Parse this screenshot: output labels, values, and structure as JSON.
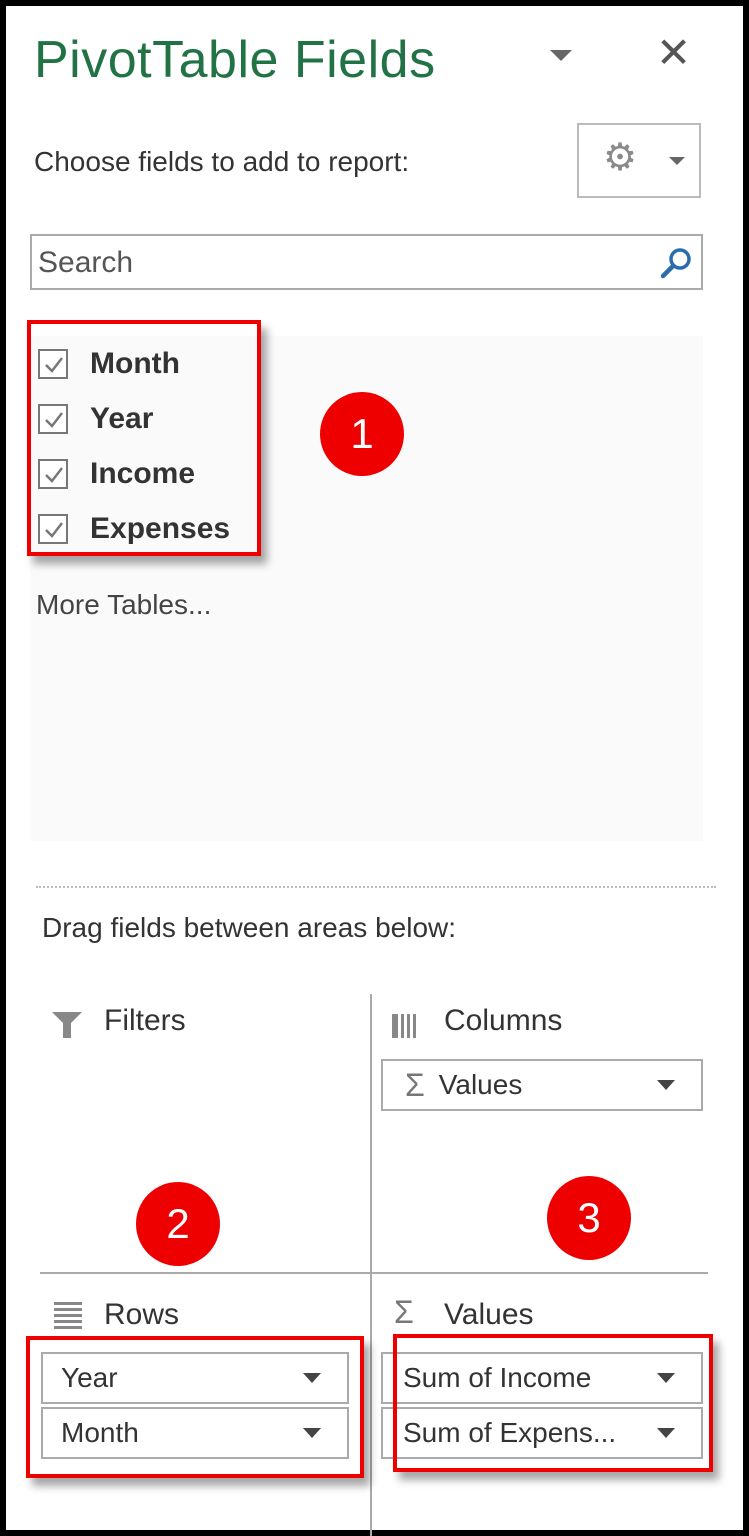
{
  "pane": {
    "title": "PivotTable Fields",
    "choose_label": "Choose fields to add to report:",
    "search": {
      "placeholder": "Search",
      "value": ""
    },
    "fields": [
      {
        "label": "Month",
        "checked": true
      },
      {
        "label": "Year",
        "checked": true
      },
      {
        "label": "Income",
        "checked": true
      },
      {
        "label": "Expenses",
        "checked": true
      }
    ],
    "more_tables": "More Tables...",
    "drag_label": "Drag fields between areas below:",
    "areas": {
      "filters": {
        "label": "Filters",
        "items": []
      },
      "columns": {
        "label": "Columns",
        "items": [
          {
            "label": "Values",
            "icon": "sigma-icon"
          }
        ]
      },
      "rows": {
        "label": "Rows",
        "items": [
          {
            "label": "Year"
          },
          {
            "label": "Month"
          }
        ]
      },
      "values": {
        "label": "Values",
        "items": [
          {
            "label": "Sum of Income"
          },
          {
            "label": "Sum of Expens..."
          }
        ]
      }
    }
  },
  "annotations": {
    "badges": [
      "1",
      "2",
      "3"
    ],
    "highlight_color": "#e00000"
  },
  "colors": {
    "title": "#217346",
    "search_icon": "#2b6cb0"
  }
}
